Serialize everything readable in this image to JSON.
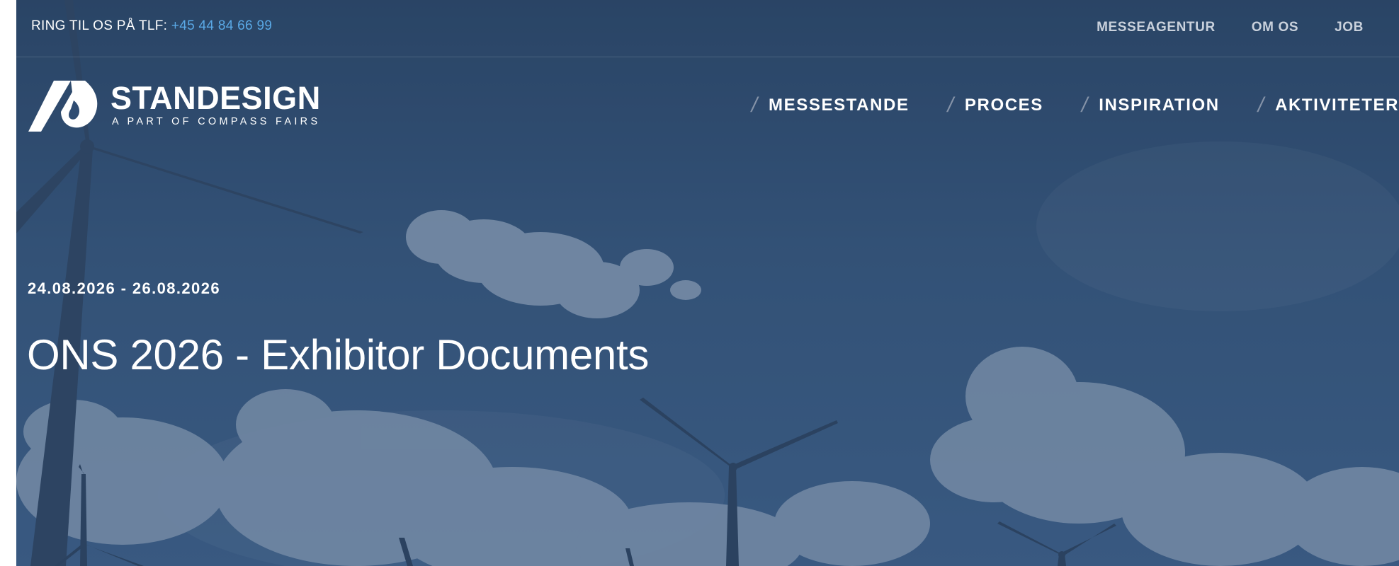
{
  "topbar": {
    "phone_label": "RING TIL OS PÅ TLF:",
    "phone_number": "+45 44 84 66 99",
    "links": [
      "MESSEAGENTUR",
      "OM OS",
      "JOB"
    ]
  },
  "logo": {
    "name": "STANDESIGN",
    "tagline": "A PART OF COMPASS FAIRS"
  },
  "main_nav": [
    "MESSESTANDE",
    "PROCES",
    "INSPIRATION",
    "AKTIVITETER"
  ],
  "hero": {
    "date": "24.08.2026 - 26.08.2026",
    "title": "ONS 2026 - Exhibitor Documents"
  },
  "colors": {
    "accent_link": "#5aa9e6",
    "hero_overlay": "#2f4c72",
    "text": "#ffffff"
  }
}
